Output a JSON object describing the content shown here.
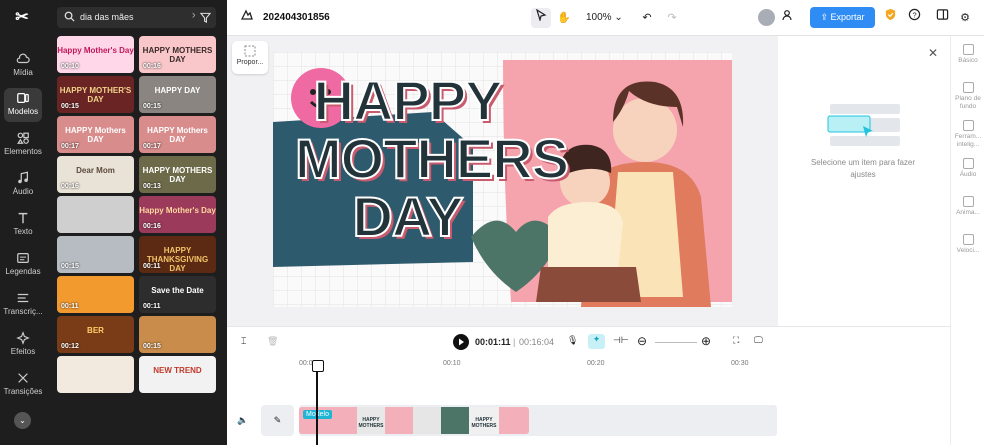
{
  "project": {
    "name": "202404301856"
  },
  "nav": {
    "logo": "✂",
    "items": [
      {
        "label": "Mídia",
        "icon": "cloud-upload-icon"
      },
      {
        "label": "Modelos",
        "icon": "templates-icon",
        "active": true
      },
      {
        "label": "Elementos",
        "icon": "elements-icon"
      },
      {
        "label": "Áudio",
        "icon": "music-icon"
      },
      {
        "label": "Texto",
        "icon": "text-icon"
      },
      {
        "label": "Legendas",
        "icon": "captions-icon"
      },
      {
        "label": "Transcriç...",
        "icon": "transcript-icon"
      },
      {
        "label": "Efeitos",
        "icon": "effects-icon"
      },
      {
        "label": "Transições",
        "icon": "transitions-icon"
      }
    ]
  },
  "search": {
    "value": "dia das mães"
  },
  "templates": [
    {
      "duration": "00:10",
      "title": "Happy Mother's Day",
      "theme": "pink"
    },
    {
      "duration": "00:16",
      "title": "HAPPY MOTHERS DAY",
      "theme": "pinkdark"
    },
    {
      "duration": "00:15",
      "title": "HAPPY MOTHER'S DAY",
      "theme": "red"
    },
    {
      "duration": "00:15",
      "title": "HAPPY DAY",
      "theme": "photo"
    },
    {
      "duration": "00:17",
      "title": "HAPPY Mothers DAY",
      "theme": "rose"
    },
    {
      "duration": "00:17",
      "title": "HAPPY Mothers DAY",
      "theme": "rose"
    },
    {
      "duration": "00:16",
      "title": "Dear Mom",
      "theme": "beige"
    },
    {
      "duration": "00:13",
      "title": "HAPPY MOTHERS DAY",
      "theme": "olive"
    },
    {
      "duration": "",
      "title": "",
      "theme": "grey"
    },
    {
      "duration": "00:16",
      "title": "Happy Mother's Day",
      "theme": "magenta"
    },
    {
      "duration": "00:15",
      "title": "",
      "theme": "lightgrey"
    },
    {
      "duration": "00:11",
      "title": "HAPPY THANKSGIVING DAY",
      "theme": "autumn"
    },
    {
      "duration": "00:11",
      "title": "",
      "theme": "orange"
    },
    {
      "duration": "00:11",
      "title": "Save the Date",
      "theme": "dark"
    },
    {
      "duration": "00:12",
      "title": "BER",
      "theme": "food"
    },
    {
      "duration": "00:15",
      "title": "",
      "theme": "photos"
    },
    {
      "duration": "",
      "title": "",
      "theme": "cream"
    },
    {
      "duration": "",
      "title": "NEW TREND",
      "theme": "trend"
    }
  ],
  "toolbar": {
    "zoom": "100%",
    "export_label": "Exportar"
  },
  "canvas": {
    "proportion_label": "Propor...",
    "poster_lines": [
      "HAPPY",
      "MOTHERS",
      "DAY"
    ]
  },
  "right_panel": {
    "empty_text": "Selecione um item para fazer ajustes"
  },
  "right_tools": [
    {
      "label": "Básico"
    },
    {
      "label": "Plano de fundo"
    },
    {
      "label": "Ferram... intelig..."
    },
    {
      "label": "Áudio"
    },
    {
      "label": "Anima..."
    },
    {
      "label": "Veloci..."
    }
  ],
  "timeline": {
    "current_time": "00:01:11",
    "total_time": "00:16:04",
    "ruler": [
      "00:00",
      "00:10",
      "00:20",
      "00:30"
    ],
    "track_label": "Modelo"
  },
  "colors": {
    "accent": "#2f8cf5",
    "panel": "#1e1e1e",
    "clip_label": "#1fb6d6"
  }
}
